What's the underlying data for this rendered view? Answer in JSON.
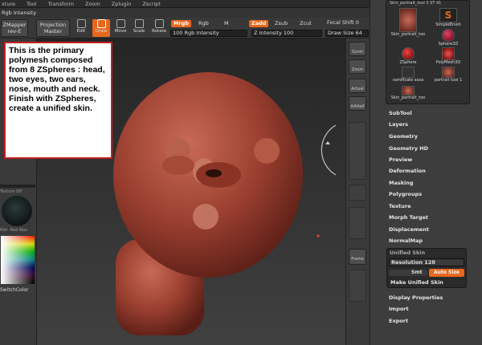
{
  "menu": [
    "xture",
    "Tool",
    "Transform",
    "Zoom",
    "Zplugin",
    "Zscript"
  ],
  "sub_bar_label": "Rgb Intensity",
  "zmapper": {
    "line1": "ZMapper",
    "line2": "rev-E"
  },
  "projection_master": {
    "line1": "Projection",
    "line2": "Master"
  },
  "tools": [
    "Edit",
    "Draw",
    "Move",
    "Scale",
    "Rotate"
  ],
  "mrgb": "Mrgb",
  "rgb": "Rgb",
  "m": "M",
  "rgb_intensity": "100 Rgb Intensity",
  "zadd": "Zadd",
  "zsub": "Zsub",
  "zcut": "Zcut",
  "focal_shift": "Focal Shift 0",
  "z_intensity": "Z Intensity 100",
  "draw_size": "Draw Size 64",
  "left_labels": {
    "texture": "Texture Off",
    "material": "Mat. Red Wax",
    "switch_color": "SwitchColor"
  },
  "right_shelf": [
    "Scroll",
    "Zoom",
    "Actual",
    "AAHalf",
    "Frame"
  ],
  "tool_palette": {
    "title": "Skin_portrait_tool 3 ST 41",
    "thumbs": [
      "Skin_portrait_too",
      "SimpleBrush",
      "Sphere3D",
      "ZSphere",
      "PolyMesh3D",
      "ramificate sosa",
      "portrait tool 1",
      "Skin_portrait_too"
    ]
  },
  "sections": [
    "SubTool",
    "Layers",
    "Geometry",
    "Geometry HD",
    "Preview",
    "Deformation",
    "Masking",
    "Polygroups",
    "Texture",
    "Morph Target",
    "Displacement",
    "NormalMap",
    "Unified Skin"
  ],
  "unified_skin": {
    "resolution": "Resolution 128",
    "smt": "Smt",
    "auto_size": "Auto Size",
    "make": "Make Unified Skin"
  },
  "sections_after": [
    "Display Properties",
    "Import",
    "Export"
  ],
  "callout": "This is the primary polymesh composed from 8 ZSpheres : head, two eyes, two ears, nose, mouth and neck.\nFinish with ZSpheres, create a unified skin."
}
